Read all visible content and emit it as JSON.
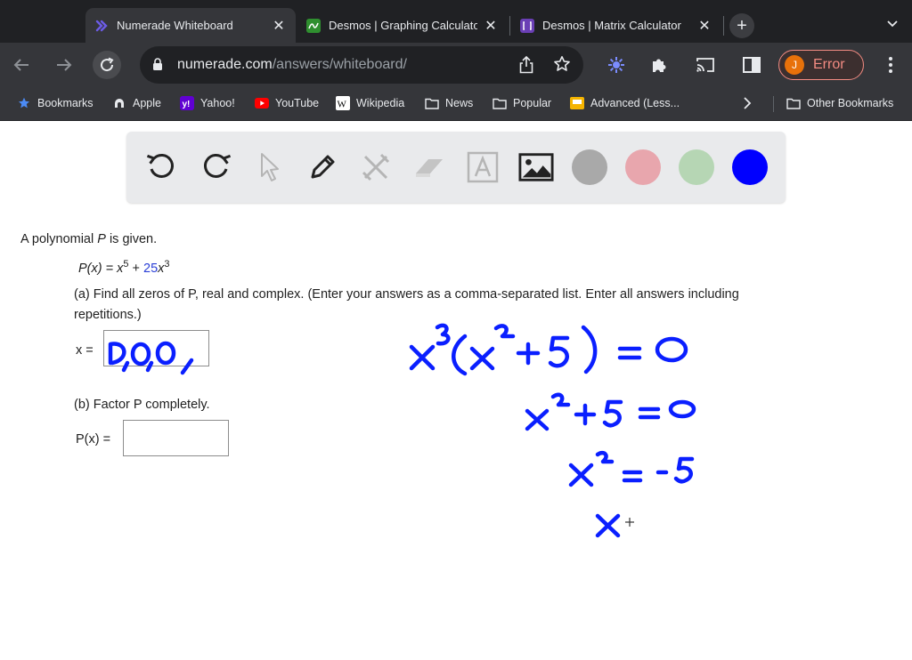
{
  "browser": {
    "tabs": [
      {
        "title": "Numerade Whiteboard",
        "favicon": "numerade-icon",
        "active": true
      },
      {
        "title": "Desmos | Graphing Calculator",
        "favicon": "desmos-graph-icon",
        "active": false
      },
      {
        "title": "Desmos | Matrix Calculator",
        "favicon": "desmos-matrix-icon",
        "active": false
      }
    ],
    "url_host": "numerade.com",
    "url_path": "/answers/whiteboard/",
    "profile_initial": "J",
    "profile_status": "Error",
    "bookmarks": [
      {
        "label": "Bookmarks",
        "icon": "star-icon"
      },
      {
        "label": "Apple",
        "icon": "apple-icon"
      },
      {
        "label": "Yahoo!",
        "icon": "yahoo-icon"
      },
      {
        "label": "YouTube",
        "icon": "youtube-icon"
      },
      {
        "label": "Wikipedia",
        "icon": "wikipedia-icon"
      },
      {
        "label": "News",
        "icon": "folder-icon"
      },
      {
        "label": "Popular",
        "icon": "folder-icon"
      },
      {
        "label": "Advanced (Less...",
        "icon": "bookmark-yellow-icon"
      }
    ],
    "other_bookmarks": "Other Bookmarks"
  },
  "whiteboard": {
    "tools": [
      "undo",
      "redo",
      "select",
      "pen",
      "tools",
      "eraser",
      "text",
      "image"
    ],
    "colors": [
      "#a9a9a9",
      "#e8a6ad",
      "#b6d6b4",
      "#0000ff"
    ],
    "selected_color": "#0000ff",
    "ink_color": "#0a1fff"
  },
  "problem": {
    "intro_1": "A polynomial ",
    "intro_var": "P",
    "intro_2": " is given.",
    "eq_lhs": "P(x) = x",
    "eq_exp1": "5",
    "eq_plus": " + ",
    "eq_coef": "25",
    "eq_x": "x",
    "eq_exp2": "3",
    "part_a_line1": "(a) Find all zeros of P, real and complex. (Enter your answers as a comma-separated list. Enter all answers including",
    "part_a_line2": "repetitions.)",
    "part_a_label": "x =",
    "part_b": "(b) Factor P completely.",
    "part_b_label": "P(x) ="
  }
}
